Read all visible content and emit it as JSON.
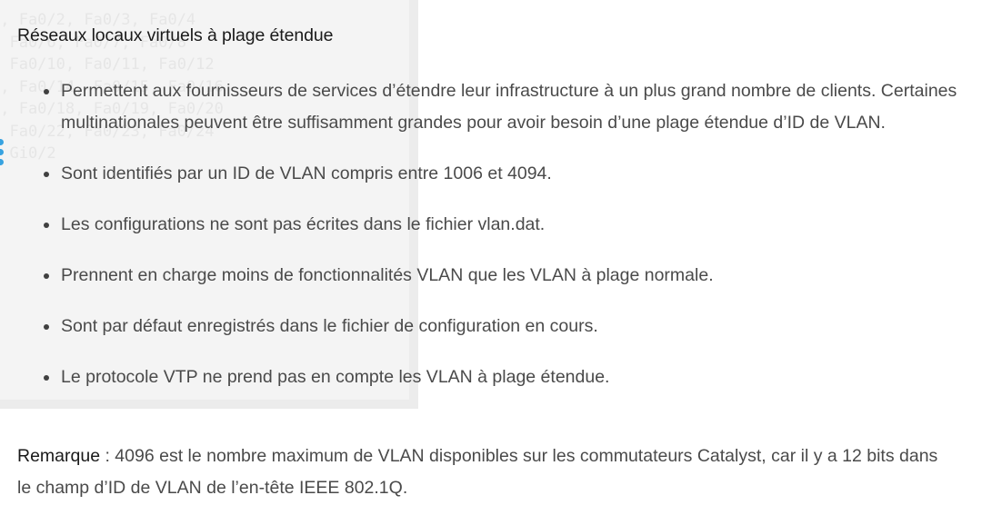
{
  "background_terminal": {
    "lines": [
      "/, Fa0/2, Fa0/3, Fa0/4",
      ", Fa0/6, Fa0/7, Fa0/8",
      ", Fa0/10, Fa0/11, Fa0/12",
      "3, Fa0/14, Fa0/15, Fa0/16",
      "7, Fa0/18, Fa0/19, Fa0/20",
      ", Fa0/22, Fa0/23, Fa0/24",
      ", Gi0/2"
    ]
  },
  "section": {
    "title": "Réseaux locaux virtuels à plage étendue"
  },
  "bullets": [
    {
      "text": "Permettent aux fournisseurs de services d’étendre leur infrastructure à un plus grand nombre de clients. Certaines multinationales peuvent être suffisamment grandes pour avoir besoin d’une plage étendue d’ID de VLAN."
    },
    {
      "text": "Sont identifiés par un ID de VLAN compris entre 1006 et 4094."
    },
    {
      "text": "Les configurations ne sont pas écrites dans le fichier vlan.dat."
    },
    {
      "text": "Prennent en charge moins de fonctionnalités VLAN que les VLAN à plage normale."
    },
    {
      "text": "Sont par défaut enregistrés dans le fichier de configuration en cours."
    },
    {
      "text": "Le protocole VTP ne prend pas en compte les VLAN à plage étendue."
    }
  ],
  "note": {
    "label": "Remarque",
    "text": " : 4096 est le nombre maximum de VLAN disponibles sur les commutateurs Catalyst, car il y a 12 bits dans le champ d’ID de VLAN de l’en-tête IEEE 802.1Q."
  },
  "colors": {
    "text_body": "#4a4a4a",
    "text_title": "#1a1a1a",
    "accent_dots": "#38a3e0"
  }
}
